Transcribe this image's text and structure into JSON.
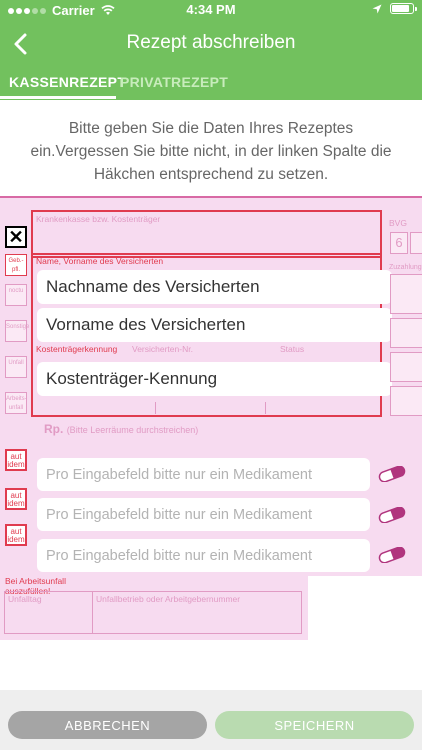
{
  "status_bar": {
    "carrier": "Carrier",
    "time": "4:34 PM"
  },
  "header": {
    "title": "Rezept abschreiben",
    "tabs": [
      {
        "label": "KASSENREZEPT",
        "active": true
      },
      {
        "label": "PRIVATREZEPT",
        "active": false
      }
    ]
  },
  "intro_text": "Bitte geben Sie die Daten Ihres Rezeptes ein.Vergessen Sie bitte nicht, in der linken Spalte die Häkchen entsprechend zu setzen.",
  "form": {
    "left_column": {
      "checked_mark": "✕",
      "geb_pfl": "Geb.-pfl.",
      "noctu": "noctu",
      "sonstige": "Sonstige",
      "unfall": "Unfall",
      "arbeitsunfall": "Arbeits-unfall"
    },
    "labels": {
      "krankenkasse": "Krankenkasse bzw. Kostenträger",
      "name": "Name, Vorname des Versicherten",
      "kostentraegerkennung": "Kostenträgerkennung",
      "versicherten_nr": "Versicherten-Nr.",
      "status": "Status",
      "rp": "Rp.",
      "rp_hint": "(Bitte Leerräume durchstreichen)",
      "bvg": "BVG",
      "zuzahlung": "Zuzahlung",
      "bei_arbeitsunfall": "Bei Arbeitsunfall auszufüllen!",
      "unfalltag": "Unfalltag",
      "unfallbetrieb": "Unfallbetrieb oder Arbeitgebernummer",
      "bvg_digit": "6"
    },
    "fields": {
      "nachname": "Nachname des Versicherten",
      "vorname": "Vorname des Versicherten",
      "kostentraeger": "Kostenträger-Kennung"
    },
    "aut_idem_label": "aut idem",
    "medication_placeholder": "Pro Eingabefeld bitte nur ein Medikament",
    "medications": [
      {
        "placeholder": "Pro Eingabefeld bitte nur ein Medikament"
      },
      {
        "placeholder": "Pro Eingabefeld bitte nur ein Medikament"
      },
      {
        "placeholder": "Pro Eingabefeld bitte nur ein Medikament"
      }
    ]
  },
  "footer": {
    "cancel": "ABBRECHEN",
    "save": "SPEICHERN"
  },
  "colors": {
    "brand_green": "#72c15e",
    "form_pink": "#f7dbf0",
    "form_red": "#e03b4f",
    "pill_magenta": "#b0357e"
  }
}
